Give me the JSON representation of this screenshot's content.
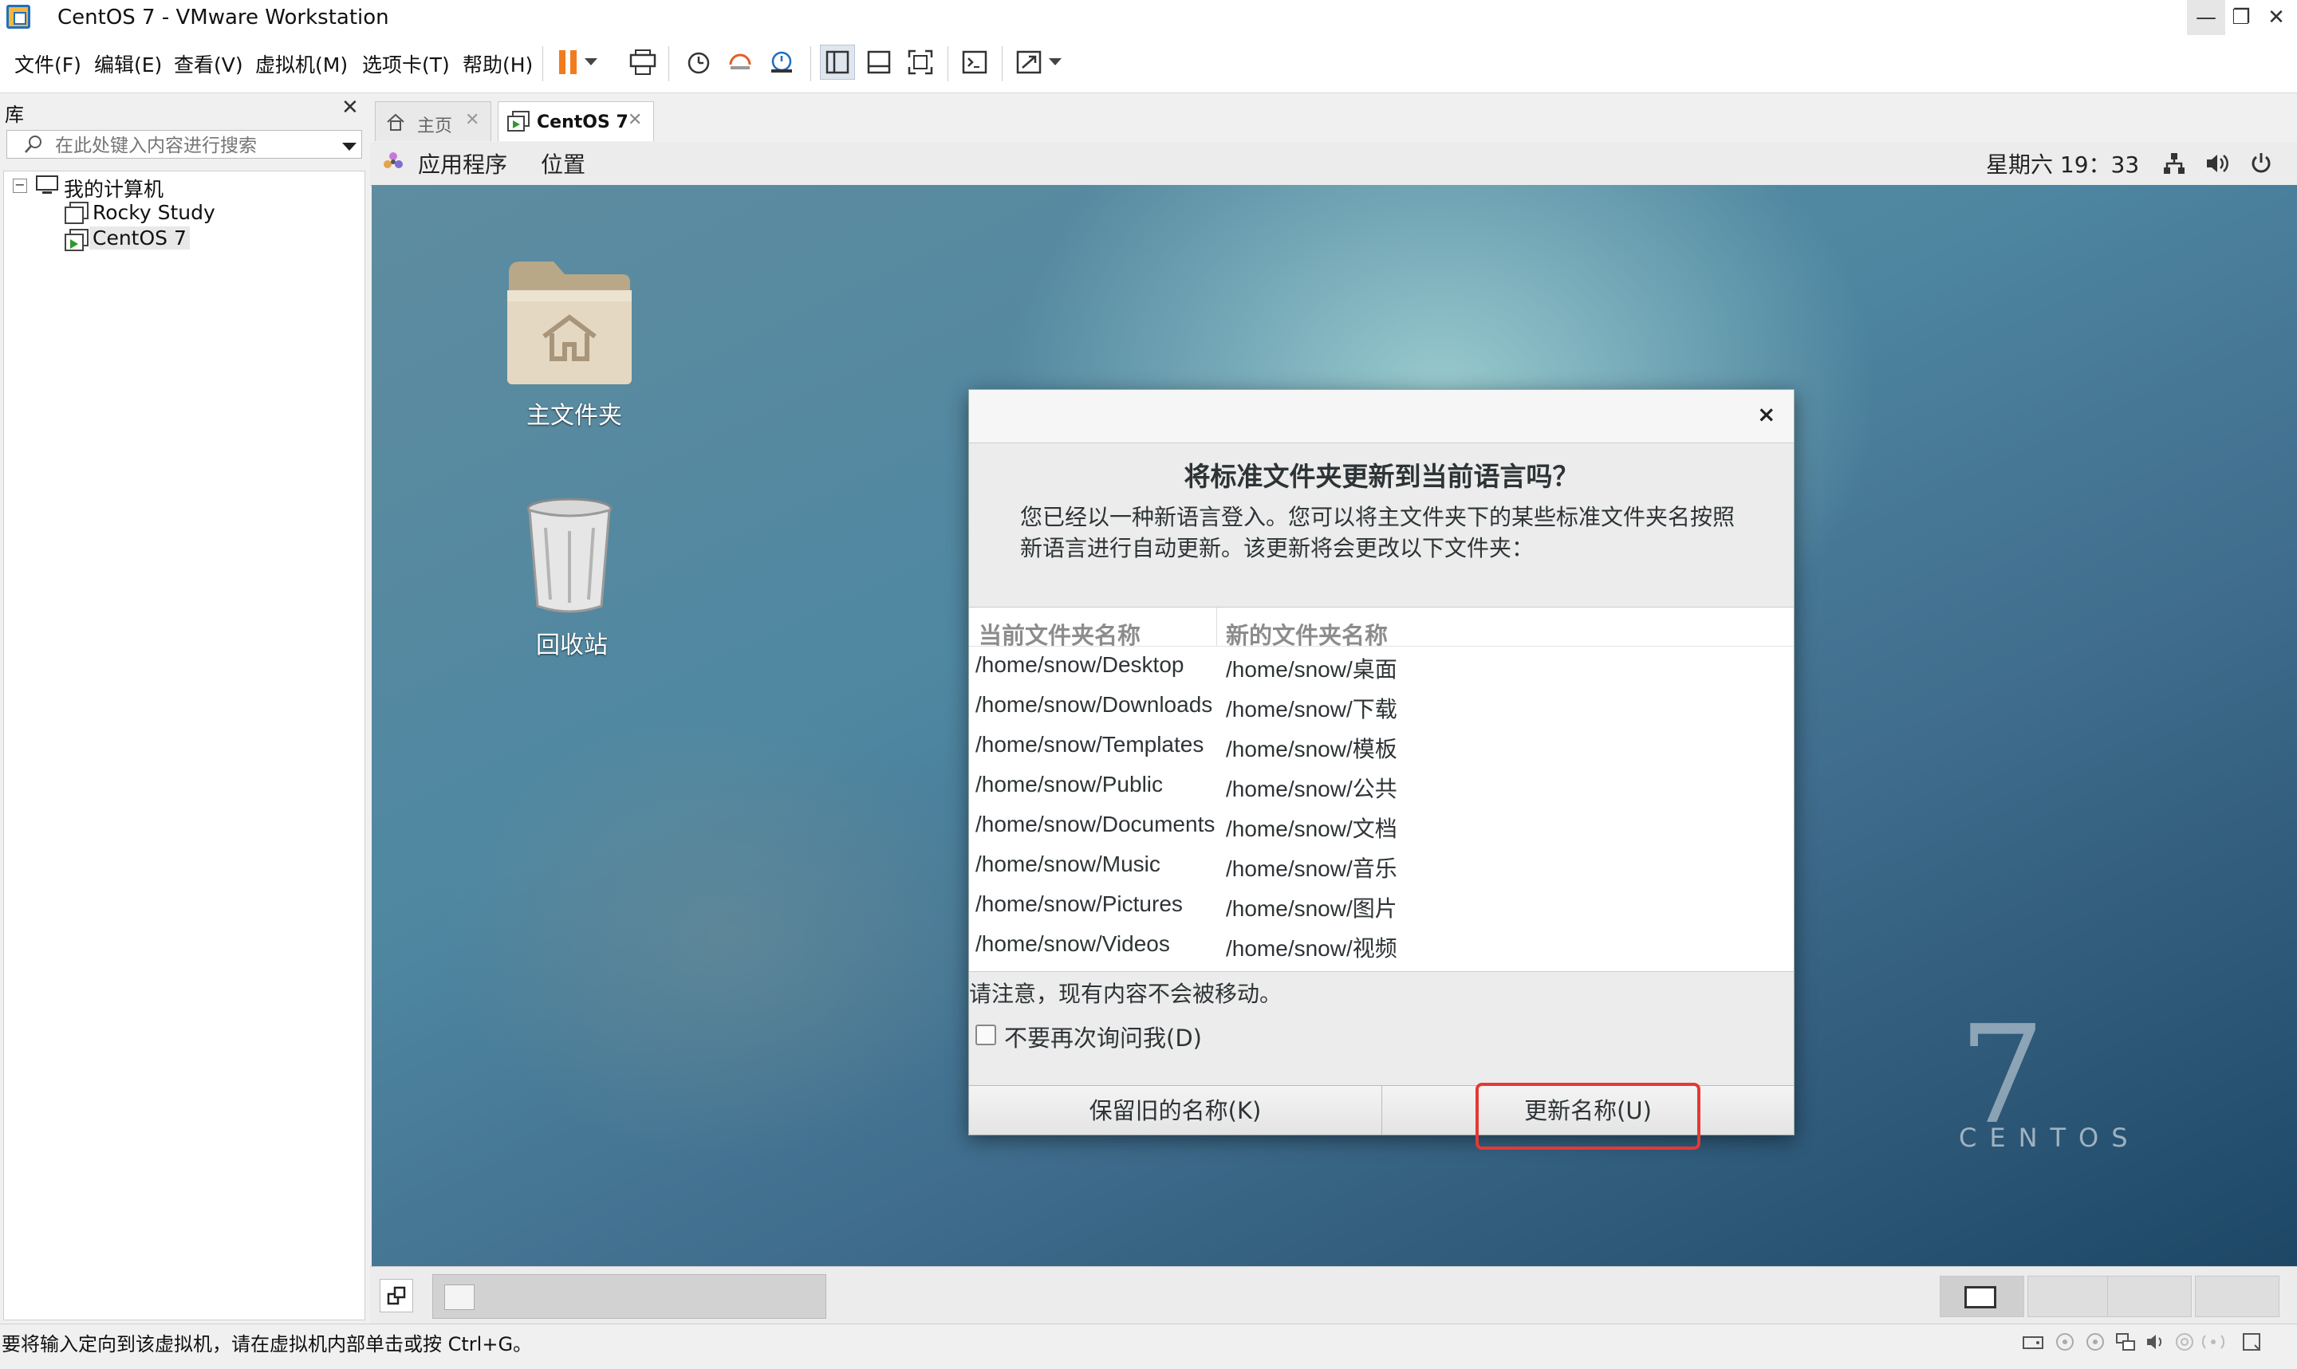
{
  "window": {
    "title": "CentOS 7 - VMware Workstation",
    "minimize": "—",
    "maximize": "❐",
    "close": "✕"
  },
  "menubar": [
    "文件(F)",
    "编辑(E)",
    "查看(V)",
    "虚拟机(M)",
    "选项卡(T)",
    "帮助(H)"
  ],
  "library": {
    "title": "库",
    "close": "✕",
    "search_placeholder": "在此处键入内容进行搜索",
    "tree": {
      "root": "我的计算机",
      "items": [
        "Rocky Study",
        "CentOS 7"
      ],
      "selected": "CentOS 7"
    }
  },
  "tabs": [
    {
      "label": "主页",
      "active": false
    },
    {
      "label": "CentOS 7",
      "active": true
    }
  ],
  "guest_panel": {
    "applications": "应用程序",
    "places": "位置",
    "clock": "星期六 19：33"
  },
  "desktop": {
    "icons": [
      "主文件夹",
      "回收站"
    ],
    "watermark_number": "7",
    "watermark_word": "CENTOS"
  },
  "dialog": {
    "close": "×",
    "title": "将标准文件夹更新到当前语言吗？",
    "description_line1": "您已经以一种新语言登入。您可以将主文件夹下的某些标准文件夹名按照",
    "description_line2": "新语言进行自动更新。该更新将会更改以下文件夹：",
    "columns": [
      "当前文件夹名称",
      "新的文件夹名称"
    ],
    "rows": [
      [
        "/home/snow/Desktop",
        "/home/snow/桌面"
      ],
      [
        "/home/snow/Downloads",
        "/home/snow/下载"
      ],
      [
        "/home/snow/Templates",
        "/home/snow/模板"
      ],
      [
        "/home/snow/Public",
        "/home/snow/公共"
      ],
      [
        "/home/snow/Documents",
        "/home/snow/文档"
      ],
      [
        "/home/snow/Music",
        "/home/snow/音乐"
      ],
      [
        "/home/snow/Pictures",
        "/home/snow/图片"
      ],
      [
        "/home/snow/Videos",
        "/home/snow/视频"
      ]
    ],
    "note": "请注意，现有内容不会被移动。",
    "checkbox_label": "不要再次询问我(D)",
    "checkbox_checked": false,
    "keep_button": "保留旧的名称(K)",
    "update_button": "更新名称(U)"
  },
  "status": {
    "message": "要将输入定向到该虚拟机，请在虚拟机内部单击或按 Ctrl+G。"
  },
  "colors": {
    "highlight": "#e53935",
    "pause_accent": "#f07c1e",
    "app_icon": "#1f6fbf"
  }
}
